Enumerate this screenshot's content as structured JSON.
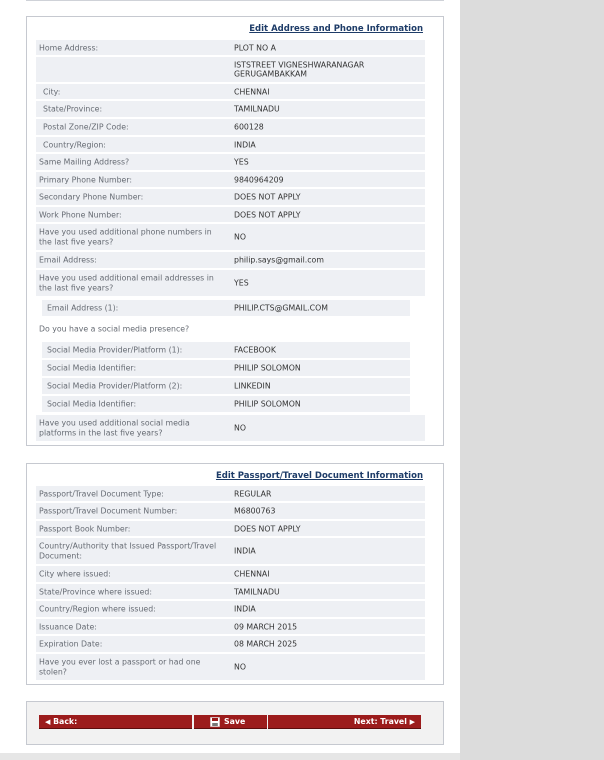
{
  "address_section": {
    "edit_link": "Edit Address and Phone Information",
    "rows": [
      {
        "label": "Home Address:",
        "value": "PLOT NO A"
      },
      {
        "label": "",
        "value": "ISTSTREET VIGNESHWARANAGAR"
      },
      {
        "label": "",
        "value": "GERUGAMBAKKAM"
      },
      {
        "label": "City:",
        "value": "CHENNAI"
      },
      {
        "label": "State/Province:",
        "value": "TAMILNADU"
      },
      {
        "label": "Postal Zone/ZIP Code:",
        "value": "600128"
      },
      {
        "label": "Country/Region:",
        "value": "INDIA"
      },
      {
        "label": "Same Mailing Address?",
        "value": "YES"
      },
      {
        "label": "Primary Phone Number:",
        "value": "9840964209"
      },
      {
        "label": "Secondary Phone Number:",
        "value": "DOES NOT APPLY"
      },
      {
        "label": "Work Phone Number:",
        "value": "DOES NOT APPLY"
      },
      {
        "label": "Have you used additional phone numbers in the last five years?",
        "value": "NO"
      },
      {
        "label": "Email Address:",
        "value": "philip.says@gmail.com"
      },
      {
        "label": "Have you used additional email addresses in the last five years?",
        "value": "YES"
      },
      {
        "label": "Email Address (1):",
        "value": "PHILIP.CTS@GMAIL.COM"
      },
      {
        "label": "Do you have a social media presence?",
        "value": ""
      },
      {
        "label": "Social Media Provider/Platform (1):",
        "value": "FACEBOOK"
      },
      {
        "label": "Social Media Identifier:",
        "value": "PHILIP SOLOMON"
      },
      {
        "label": "Social Media Provider/Platform (2):",
        "value": "LINKEDIN"
      },
      {
        "label": "Social Media Identifier:",
        "value": "PHILIP SOLOMON"
      },
      {
        "label": "Have you used additional social media platforms in the last five years?",
        "value": "NO"
      }
    ]
  },
  "passport_section": {
    "edit_link": "Edit Passport/Travel Document Information",
    "rows": [
      {
        "label": "Passport/Travel Document Type:",
        "value": "REGULAR"
      },
      {
        "label": "Passport/Travel Document Number:",
        "value": "M6800763"
      },
      {
        "label": "Passport Book Number:",
        "value": "DOES NOT APPLY"
      },
      {
        "label": "Country/Authority that Issued Passport/Travel Document:",
        "value": "INDIA"
      },
      {
        "label": "City where issued:",
        "value": "CHENNAI"
      },
      {
        "label": "State/Province where issued:",
        "value": "TAMILNADU"
      },
      {
        "label": "Country/Region where issued:",
        "value": "INDIA"
      },
      {
        "label": "Issuance Date:",
        "value": "09 MARCH 2015"
      },
      {
        "label": "Expiration Date:",
        "value": "08 MARCH 2025"
      },
      {
        "label": "Have you ever lost a passport or had one stolen?",
        "value": "NO"
      }
    ]
  },
  "buttons": {
    "back": "Back:",
    "save": "Save",
    "next": "Next: Travel"
  },
  "icons": {
    "back_arrow": "triangle-left-icon",
    "save": "floppy-disk-icon",
    "next_arrow": "triangle-right-icon"
  },
  "colors": {
    "button_red": "#9c1c1c",
    "row_shade": "#eef0f4",
    "link_blue": "#1e3c68"
  }
}
